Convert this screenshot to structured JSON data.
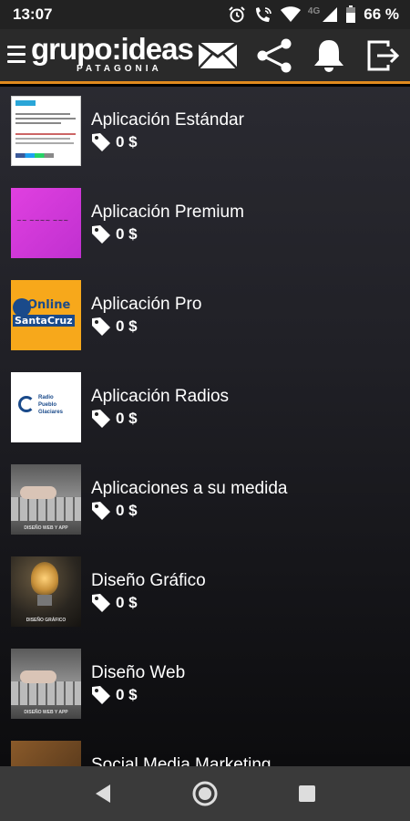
{
  "status_bar": {
    "time": "13:07",
    "network": "4G",
    "battery_percent": "66 %",
    "icons": [
      "alarm-icon",
      "wifi-calling-icon",
      "wifi-icon",
      "signal-icon",
      "battery-icon"
    ]
  },
  "app_bar": {
    "logo_main": "grupo:ideas",
    "logo_sub": "PATAGONIA",
    "accent_color": "#e08a1e",
    "actions": [
      "mail-icon",
      "share-icon",
      "bell-icon",
      "exit-icon"
    ]
  },
  "items": [
    {
      "title": "Aplicación Estándar",
      "price": "0 $",
      "thumb": "document-screenshot"
    },
    {
      "title": "Aplicación Premium",
      "price": "0 $",
      "thumb": "magenta-logo"
    },
    {
      "title": "Aplicación Pro",
      "price": "0 $",
      "thumb": "online-santacruz-logo",
      "thumb_text_1": "Online",
      "thumb_text_2": "SantaCruz"
    },
    {
      "title": "Aplicación Radios",
      "price": "0 $",
      "thumb": "radio-logo",
      "thumb_text_1": "Radio",
      "thumb_text_2": "Pueblo",
      "thumb_text_3": "Glaciares"
    },
    {
      "title": "Aplicaciones a su medida",
      "price": "0 $",
      "thumb": "keyboard-photo",
      "thumb_caption": "DISEÑO WEB Y APP"
    },
    {
      "title": "Diseño Gráfico",
      "price": "0 $",
      "thumb": "lightbulb-photo",
      "thumb_caption": "DISEÑO GRÁFICO"
    },
    {
      "title": "Diseño Web",
      "price": "0 $",
      "thumb": "keyboard-photo",
      "thumb_caption": "DISEÑO WEB Y APP"
    },
    {
      "title": "Social Media Marketing",
      "price": "",
      "thumb": "brown-photo"
    }
  ],
  "nav_bar": {
    "buttons": [
      "back-icon",
      "home-icon",
      "recents-icon"
    ]
  }
}
